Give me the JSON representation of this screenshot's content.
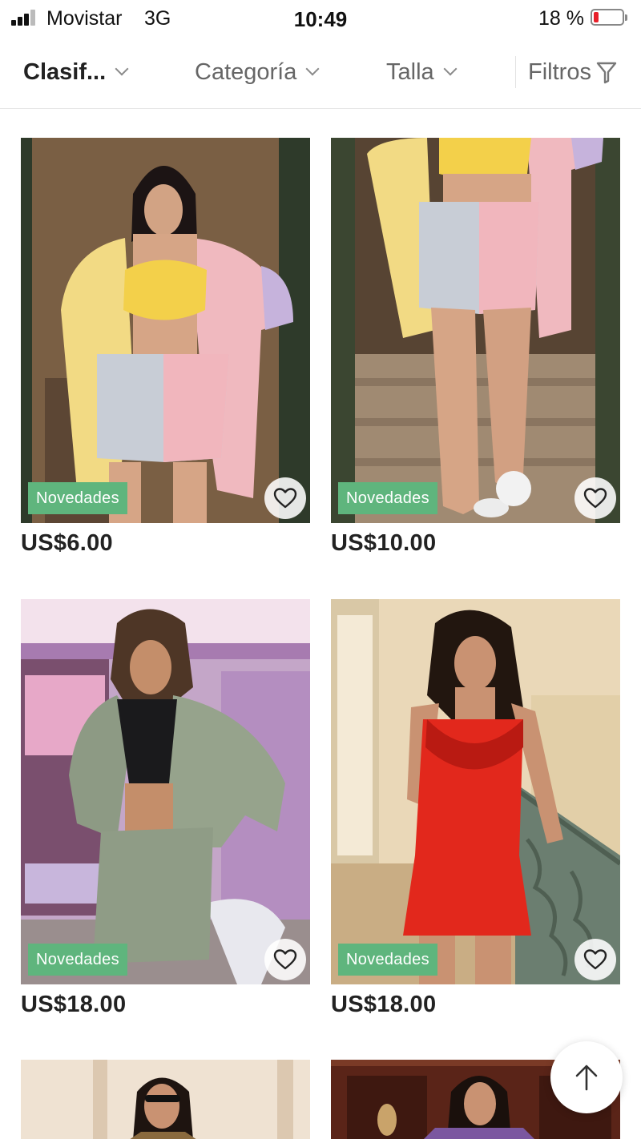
{
  "status": {
    "carrier": "Movistar",
    "network": "3G",
    "time": "10:49",
    "battery": "18 %",
    "battery_level": 0.18
  },
  "filters": {
    "sort_label": "Clasif...",
    "category_label": "Categoría",
    "size_label": "Talla",
    "filters_label": "Filtros"
  },
  "products": [
    {
      "badge": "Novedades",
      "price": "US$6.00"
    },
    {
      "badge": "Novedades",
      "price": "US$10.00"
    },
    {
      "badge": "Novedades",
      "price": "US$18.00"
    },
    {
      "badge": "Novedades",
      "price": "US$18.00"
    }
  ],
  "colors": {
    "badge": "#5fb57d",
    "battery_low": "#e8202a"
  },
  "icons": {
    "favorite": "heart-outline",
    "scroll_top": "arrow-up",
    "filters": "funnel"
  }
}
